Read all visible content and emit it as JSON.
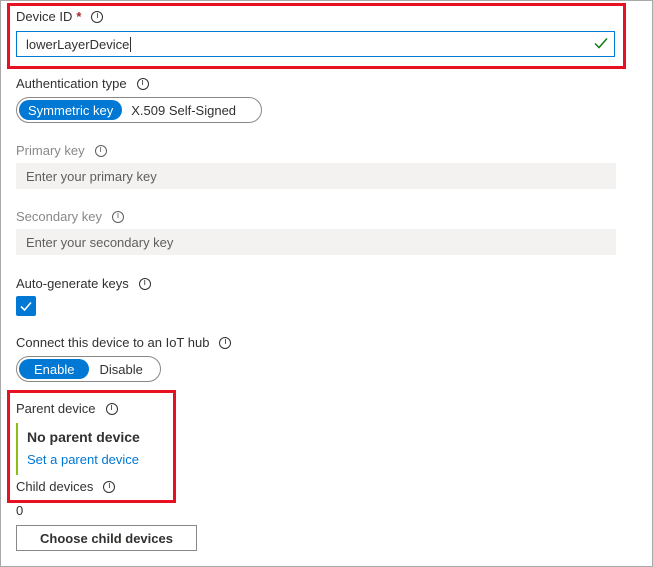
{
  "device_id": {
    "label": "Device ID",
    "required_mark": "*",
    "value": "lowerLayerDevice"
  },
  "auth_type": {
    "label": "Authentication type",
    "options": [
      "Symmetric key",
      "X.509 Self-Signed"
    ],
    "selected": "Symmetric key"
  },
  "primary_key": {
    "label": "Primary key",
    "placeholder": "Enter your primary key"
  },
  "secondary_key": {
    "label": "Secondary key",
    "placeholder": "Enter your secondary key"
  },
  "auto_generate": {
    "label": "Auto-generate keys",
    "checked": true
  },
  "connect_hub": {
    "label": "Connect this device to an IoT hub",
    "options": [
      "Enable",
      "Disable"
    ],
    "selected": "Enable"
  },
  "parent_device": {
    "label": "Parent device",
    "value": "No parent device",
    "link": "Set a parent device"
  },
  "child_devices": {
    "label": "Child devices",
    "count": "0",
    "button": "Choose child devices"
  },
  "info_glyph": "i",
  "colors": {
    "accent": "#0078d4",
    "highlight_box": "#e81123",
    "valid_check": "#107c10",
    "parent_bar": "#8cbd18"
  }
}
